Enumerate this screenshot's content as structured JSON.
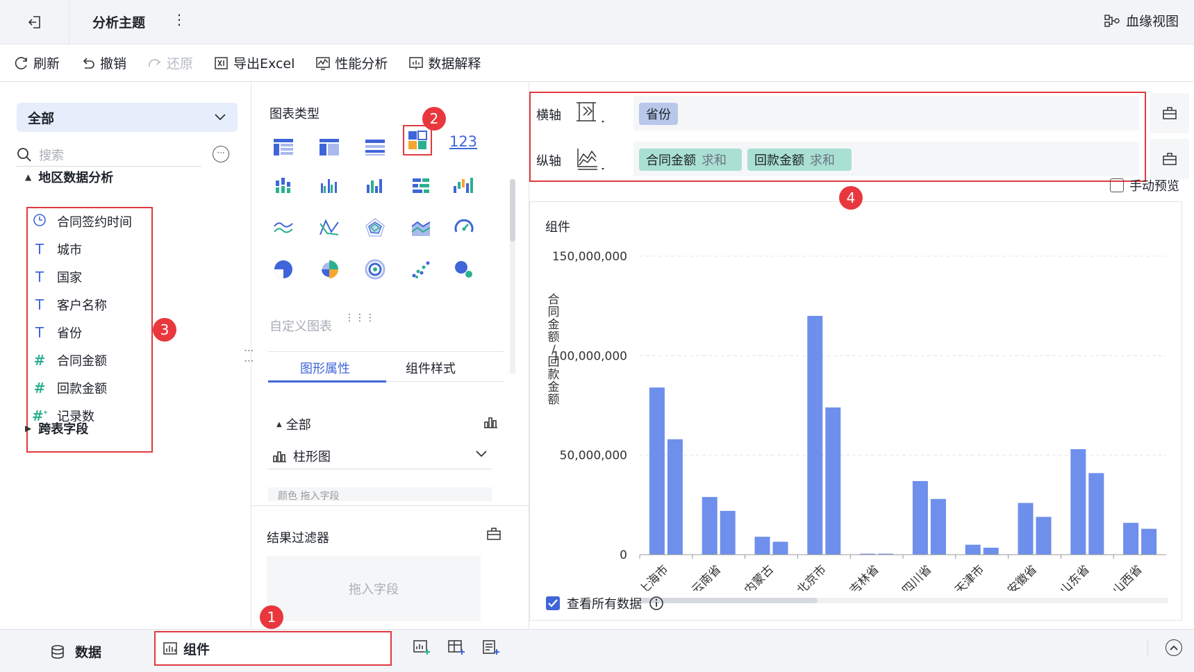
{
  "titlebar": {
    "title": "分析主题",
    "more": "⋮",
    "lineage": "血缘视图"
  },
  "toolbar": {
    "refresh": "刷新",
    "undo": "撤销",
    "redo": "还原",
    "export": "导出Excel",
    "perf": "性能分析",
    "explain": "数据解释"
  },
  "left": {
    "dropdown": "全部",
    "search_placeholder": "搜索",
    "group": "地区数据分析",
    "fields": [
      {
        "label": "合同签约时间",
        "icon": "clock-icon"
      },
      {
        "label": "城市",
        "icon": "text-icon"
      },
      {
        "label": "国家",
        "icon": "text-icon"
      },
      {
        "label": "客户名称",
        "icon": "text-icon"
      },
      {
        "label": "省份",
        "icon": "text-icon"
      },
      {
        "label": "合同金额",
        "icon": "number-icon"
      },
      {
        "label": "回款金额",
        "icon": "number-icon"
      },
      {
        "label": "记录数",
        "icon": "number-star-icon"
      }
    ],
    "cross_table": "跨表字段"
  },
  "middle": {
    "chart_type_title": "图表类型",
    "chart_123": "123",
    "custom_chart": "自定义图表",
    "tabs": [
      "图形属性",
      "组件样式"
    ],
    "section_all": "全部",
    "bar_select": "柱形图",
    "cut_text": "颜色   拖入字段",
    "filter_title": "结果过滤器",
    "filter_placeholder": "拖入字段"
  },
  "right": {
    "x_axis": {
      "label": "横轴",
      "fields": [
        {
          "name": "省份"
        }
      ]
    },
    "y_axis": {
      "label": "纵轴",
      "fields": [
        {
          "name": "合同金额",
          "agg": "求和"
        },
        {
          "name": "回款金额",
          "agg": "求和"
        }
      ]
    },
    "manual_preview": "手动预览",
    "preview_title": "组件",
    "view_all": "查看所有数据"
  },
  "bottom": {
    "data": "数据",
    "component": "组件"
  },
  "markers": [
    "1",
    "2",
    "3",
    "4"
  ],
  "colors": {
    "accent": "#3f66d8",
    "bar": "#6e8feb",
    "marker": "#e8383d",
    "highlight": "#e0393e"
  },
  "chart_data": {
    "type": "bar",
    "title": "",
    "ylabel": "合同金额/回款金额",
    "ylim": [
      0,
      150000000
    ],
    "yticks": [
      "0",
      "50,000,000",
      "100,000,000",
      "150,000,000"
    ],
    "categories": [
      "上海市",
      "云南省",
      "内蒙古",
      "北京市",
      "吉林省",
      "四川省",
      "天津市",
      "安徽省",
      "山东省",
      "山西省"
    ],
    "series": [
      {
        "values": [
          84000000,
          29000000,
          9000000,
          120000000,
          500000,
          37000000,
          5000000,
          26000000,
          53000000,
          16000000
        ]
      },
      {
        "values": [
          58000000,
          22000000,
          6500000,
          74000000,
          500000,
          28000000,
          3500000,
          19000000,
          41000000,
          13000000
        ]
      }
    ]
  }
}
